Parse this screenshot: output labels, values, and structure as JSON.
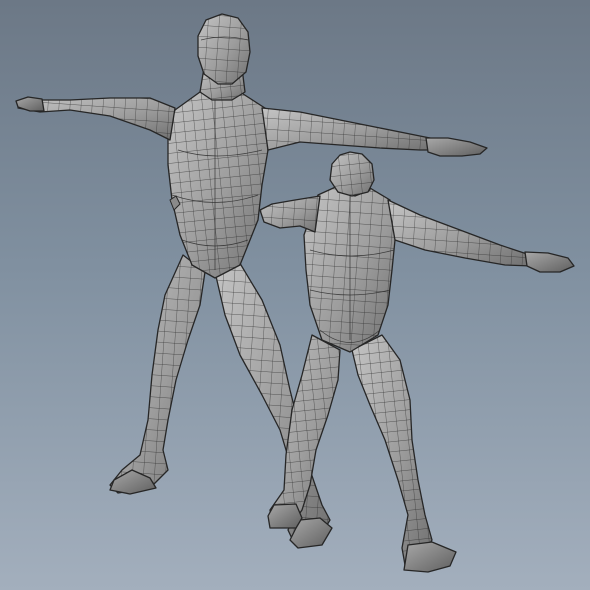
{
  "scene": {
    "background_top": "#6c7886",
    "background_bottom": "#a3afbd",
    "mesh_light": "#b9b9b9",
    "mesh_dark": "#6f6f6f",
    "wire_color": "#2b2b2b",
    "models": [
      {
        "name": "front-figure",
        "view": "front",
        "pose": "T-pose"
      },
      {
        "name": "back-figure",
        "view": "back",
        "pose": "T-pose"
      }
    ]
  }
}
